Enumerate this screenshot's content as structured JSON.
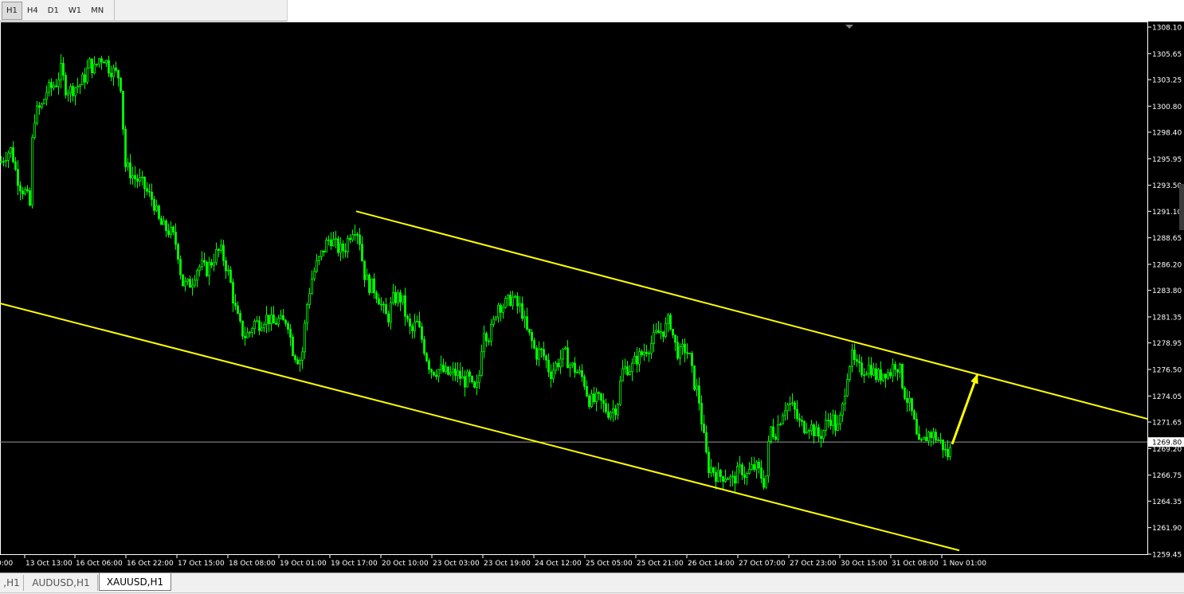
{
  "toolbar": {
    "timeframes": [
      "H1",
      "H4",
      "D1",
      "W1",
      "MN"
    ],
    "active": "H1"
  },
  "chart_data": {
    "type": "candlestick",
    "symbol": "XAUUSD",
    "timeframe": "H1",
    "background": "#000000",
    "candle_color": "#00ff00",
    "channel_color": "#ffff00",
    "price_axis": {
      "min": 1259.45,
      "max": 1308.1,
      "ticks": [
        "1308.10",
        "1305.65",
        "1303.25",
        "1300.80",
        "1298.40",
        "1295.95",
        "1293.50",
        "1291.10",
        "1288.65",
        "1286.20",
        "1283.80",
        "1281.35",
        "1278.95",
        "1276.50",
        "1274.05",
        "1271.65",
        "1269.20",
        "1266.75",
        "1264.35",
        "1261.90",
        "1259.45"
      ],
      "current_price": "1269.80"
    },
    "time_axis": {
      "labels": [
        "0:00",
        "13 Oct 13:00",
        "16 Oct 06:00",
        "16 Oct 22:00",
        "17 Oct 15:00",
        "18 Oct 08:00",
        "19 Oct 01:00",
        "19 Oct 17:00",
        "20 Oct 10:00",
        "23 Oct 03:00",
        "23 Oct 19:00",
        "24 Oct 12:00",
        "25 Oct 05:00",
        "25 Oct 21:00",
        "26 Oct 14:00",
        "27 Oct 07:00",
        "27 Oct 23:00",
        "30 Oct 15:00",
        "31 Oct 08:00",
        "1 Nov 01:00"
      ]
    },
    "close_path": [
      [
        0,
        1295.6
      ],
      [
        8,
        1296.5
      ],
      [
        14,
        1296.8
      ],
      [
        20,
        1294.5
      ],
      [
        26,
        1293.3
      ],
      [
        32,
        1292.8
      ],
      [
        37,
        1291.6
      ],
      [
        41,
        1299.5
      ],
      [
        46,
        1300.3
      ],
      [
        52,
        1300.8
      ],
      [
        58,
        1302.2
      ],
      [
        64,
        1302.5
      ],
      [
        70,
        1303.0
      ],
      [
        76,
        1304.1
      ],
      [
        82,
        1302.5
      ],
      [
        88,
        1302.3
      ],
      [
        94,
        1302.6
      ],
      [
        100,
        1302.8
      ],
      [
        106,
        1303.5
      ],
      [
        112,
        1304.7
      ],
      [
        118,
        1304.2
      ],
      [
        124,
        1305.2
      ],
      [
        130,
        1305.3
      ],
      [
        136,
        1304.4
      ],
      [
        142,
        1304.0
      ],
      [
        148,
        1303.6
      ],
      [
        152,
        1302.5
      ],
      [
        156,
        1295.4
      ],
      [
        162,
        1294.8
      ],
      [
        168,
        1294.2
      ],
      [
        174,
        1293.9
      ],
      [
        180,
        1293.4
      ],
      [
        186,
        1292.6
      ],
      [
        192,
        1292.1
      ],
      [
        198,
        1290.3
      ],
      [
        204,
        1289.6
      ],
      [
        210,
        1289.4
      ],
      [
        216,
        1288.9
      ],
      [
        222,
        1287.8
      ],
      [
        228,
        1284.5
      ],
      [
        234,
        1284.2
      ],
      [
        240,
        1284.6
      ],
      [
        246,
        1285.8
      ],
      [
        252,
        1286.1
      ],
      [
        258,
        1285.6
      ],
      [
        264,
        1286.3
      ],
      [
        270,
        1287.1
      ],
      [
        276,
        1287.5
      ],
      [
        282,
        1286.4
      ],
      [
        288,
        1284.8
      ],
      [
        294,
        1282.3
      ],
      [
        300,
        1280.6
      ],
      [
        306,
        1279.6
      ],
      [
        312,
        1279.8
      ],
      [
        318,
        1280.9
      ],
      [
        324,
        1280.7
      ],
      [
        330,
        1281.2
      ],
      [
        336,
        1281.3
      ],
      [
        342,
        1280.6
      ],
      [
        348,
        1281.1
      ],
      [
        354,
        1280.7
      ],
      [
        360,
        1281.3
      ],
      [
        366,
        1278.5
      ],
      [
        372,
        1277.6
      ],
      [
        378,
        1277.4
      ],
      [
        384,
        1282.1
      ],
      [
        390,
        1284.7
      ],
      [
        396,
        1286.0
      ],
      [
        402,
        1286.9
      ],
      [
        408,
        1288.0
      ],
      [
        414,
        1288.7
      ],
      [
        420,
        1288.0
      ],
      [
        426,
        1287.5
      ],
      [
        432,
        1287.6
      ],
      [
        438,
        1288.9
      ],
      [
        444,
        1289.8
      ],
      [
        450,
        1289.0
      ],
      [
        456,
        1285.5
      ],
      [
        462,
        1284.3
      ],
      [
        468,
        1284.1
      ],
      [
        474,
        1283.3
      ],
      [
        480,
        1282.0
      ],
      [
        486,
        1281.1
      ],
      [
        492,
        1282.9
      ],
      [
        498,
        1283.2
      ],
      [
        504,
        1283.0
      ],
      [
        510,
        1281.0
      ],
      [
        516,
        1279.8
      ],
      [
        522,
        1280.9
      ],
      [
        528,
        1279.6
      ],
      [
        534,
        1277.9
      ],
      [
        540,
        1276.5
      ],
      [
        546,
        1276.4
      ],
      [
        552,
        1276.5
      ],
      [
        558,
        1276.2
      ],
      [
        564,
        1276.0
      ],
      [
        570,
        1276.2
      ],
      [
        576,
        1275.9
      ],
      [
        582,
        1275.4
      ],
      [
        588,
        1275.7
      ],
      [
        594,
        1274.3
      ],
      [
        600,
        1275.1
      ],
      [
        606,
        1280.5
      ],
      [
        612,
        1279.5
      ],
      [
        618,
        1280.4
      ],
      [
        624,
        1282.6
      ],
      [
        630,
        1282.4
      ],
      [
        636,
        1282.6
      ],
      [
        642,
        1283.2
      ],
      [
        648,
        1282.4
      ],
      [
        654,
        1282.1
      ],
      [
        660,
        1280.1
      ],
      [
        666,
        1279.3
      ],
      [
        672,
        1277.9
      ],
      [
        678,
        1278.2
      ],
      [
        684,
        1277.5
      ],
      [
        690,
        1276.1
      ],
      [
        696,
        1276.8
      ],
      [
        702,
        1277.4
      ],
      [
        708,
        1278.0
      ],
      [
        714,
        1277.0
      ],
      [
        720,
        1276.6
      ],
      [
        726,
        1276.1
      ],
      [
        732,
        1275.6
      ],
      [
        738,
        1273.8
      ],
      [
        744,
        1273.5
      ],
      [
        750,
        1273.8
      ],
      [
        756,
        1273.2
      ],
      [
        762,
        1272.6
      ],
      [
        768,
        1272.8
      ],
      [
        774,
        1273.1
      ],
      [
        780,
        1276.3
      ],
      [
        786,
        1276.7
      ],
      [
        792,
        1276.6
      ],
      [
        798,
        1277.5
      ],
      [
        804,
        1277.8
      ],
      [
        810,
        1278.4
      ],
      [
        816,
        1278.8
      ],
      [
        822,
        1279.6
      ],
      [
        828,
        1280.0
      ],
      [
        834,
        1280.2
      ],
      [
        840,
        1281.2
      ],
      [
        846,
        1278.9
      ],
      [
        852,
        1277.8
      ],
      [
        858,
        1278.5
      ],
      [
        864,
        1277.9
      ],
      [
        870,
        1275.4
      ],
      [
        876,
        1274.2
      ],
      [
        882,
        1270.6
      ],
      [
        888,
        1267.5
      ],
      [
        894,
        1267.3
      ],
      [
        900,
        1266.6
      ],
      [
        906,
        1266.7
      ],
      [
        912,
        1266.8
      ],
      [
        918,
        1266.1
      ],
      [
        924,
        1266.8
      ],
      [
        930,
        1267.4
      ],
      [
        936,
        1266.6
      ],
      [
        942,
        1267.3
      ],
      [
        948,
        1267.5
      ],
      [
        954,
        1266.8
      ],
      [
        960,
        1265.8
      ],
      [
        966,
        1271.2
      ],
      [
        972,
        1270.5
      ],
      [
        978,
        1271.8
      ],
      [
        984,
        1273.1
      ],
      [
        990,
        1273.3
      ],
      [
        996,
        1272.8
      ],
      [
        1002,
        1271.6
      ],
      [
        1008,
        1271.2
      ],
      [
        1014,
        1271.5
      ],
      [
        1020,
        1271.0
      ],
      [
        1026,
        1270.3
      ],
      [
        1032,
        1270.7
      ],
      [
        1038,
        1271.8
      ],
      [
        1044,
        1272.1
      ],
      [
        1050,
        1270.8
      ],
      [
        1056,
        1272.4
      ],
      [
        1062,
        1275.9
      ],
      [
        1068,
        1277.8
      ],
      [
        1074,
        1276.7
      ],
      [
        1080,
        1276.4
      ],
      [
        1086,
        1276.6
      ],
      [
        1092,
        1276.8
      ],
      [
        1098,
        1275.9
      ],
      [
        1104,
        1275.9
      ],
      [
        1110,
        1276.4
      ],
      [
        1116,
        1276.1
      ],
      [
        1122,
        1277.1
      ],
      [
        1128,
        1276.7
      ],
      [
        1134,
        1274.5
      ],
      [
        1140,
        1273.4
      ],
      [
        1146,
        1271.9
      ],
      [
        1152,
        1269.3
      ],
      [
        1158,
        1269.7
      ],
      [
        1164,
        1270.6
      ],
      [
        1170,
        1270.5
      ],
      [
        1176,
        1270.1
      ],
      [
        1182,
        1269.6
      ],
      [
        1188,
        1268.5
      ],
      [
        1194,
        1269.3
      ]
    ],
    "annotations": {
      "channel_upper": [
        [
          447,
          1291.1
        ],
        [
          1442,
          1271.9
        ]
      ],
      "channel_lower": [
        [
          0,
          1282.6
        ],
        [
          1204,
          1259.8
        ]
      ],
      "arrow": [
        [
          1195,
          1269.6
        ],
        [
          1227,
          1276.1
        ]
      ]
    }
  },
  "tabs": {
    "items": [
      ",H1",
      "AUDUSD,H1",
      "XAUUSD,H1"
    ],
    "active_index": 2
  }
}
